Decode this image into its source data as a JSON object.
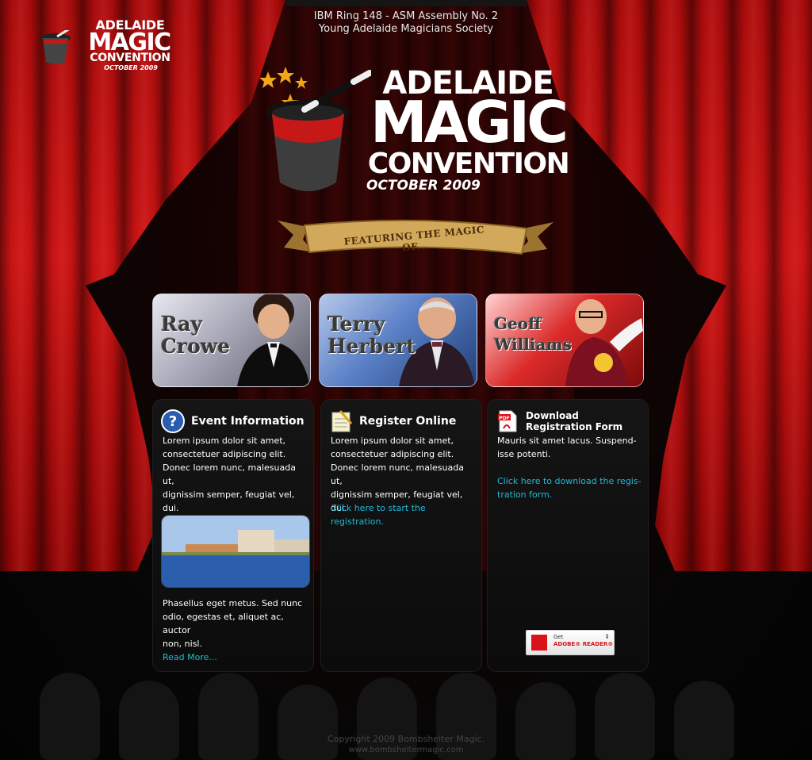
{
  "header": {
    "org_line1": "IBM Ring 148 - ASM Assembly No. 2",
    "org_line2": "Young Adelaide Magicians Society"
  },
  "logo_small": {
    "line1": "ADELAIDE",
    "line2": "MAGIC",
    "line3": "CONVENTION",
    "line4": "OCTOBER 2009"
  },
  "logo_big": {
    "line1": "ADELAIDE",
    "line2": "MAGIC",
    "line3": "CONVENTION",
    "line4": "OCTOBER 2009"
  },
  "banner": {
    "text": "FEATURING THE MAGIC OF..."
  },
  "performers": [
    {
      "first": "Ray",
      "last": "Crowe"
    },
    {
      "first": "Terry",
      "last": "Herbert"
    },
    {
      "first": "Geoff",
      "last": "Williams"
    }
  ],
  "panels": {
    "event": {
      "title": "Event Information",
      "icon": "question-icon",
      "text1": "Lorem ipsum dolor sit amet,\nconsectetuer adipiscing elit.\nDonec lorem nunc, malesuada ut,\ndignissim semper, feugiat vel, dui.\nAliquam facilisis porttitor nisl.",
      "text2": "Phasellus eget metus. Sed nunc\nodio, egestas et, aliquet ac, auctor\nnon, nisl.",
      "link": "Read More..."
    },
    "register": {
      "title": "Register Online",
      "icon": "notepad-icon",
      "text": "Lorem ipsum dolor sit amet,\nconsectetuer adipiscing elit.\nDonec lorem nunc, malesuada ut,\ndignissim semper, feugiat vel, dui.",
      "link": "Click here to start the registration."
    },
    "download": {
      "title_line1": "Download",
      "title_line2": "Registration Form",
      "icon": "pdf-icon",
      "text": "Mauris sit amet lacus. Suspend-\nisse potenti.",
      "link": "Click here to download the regis-\ntration form.",
      "badge_get": "Get",
      "badge_product": "ADOBE® READER®"
    }
  },
  "footer": {
    "copyright": "Copyright  2009 Bombshelter Magic.",
    "url": "www.bombsheltermagic.com"
  },
  "colors": {
    "curtain": "#c71313",
    "link": "#21b9d6",
    "background": "#050505"
  }
}
